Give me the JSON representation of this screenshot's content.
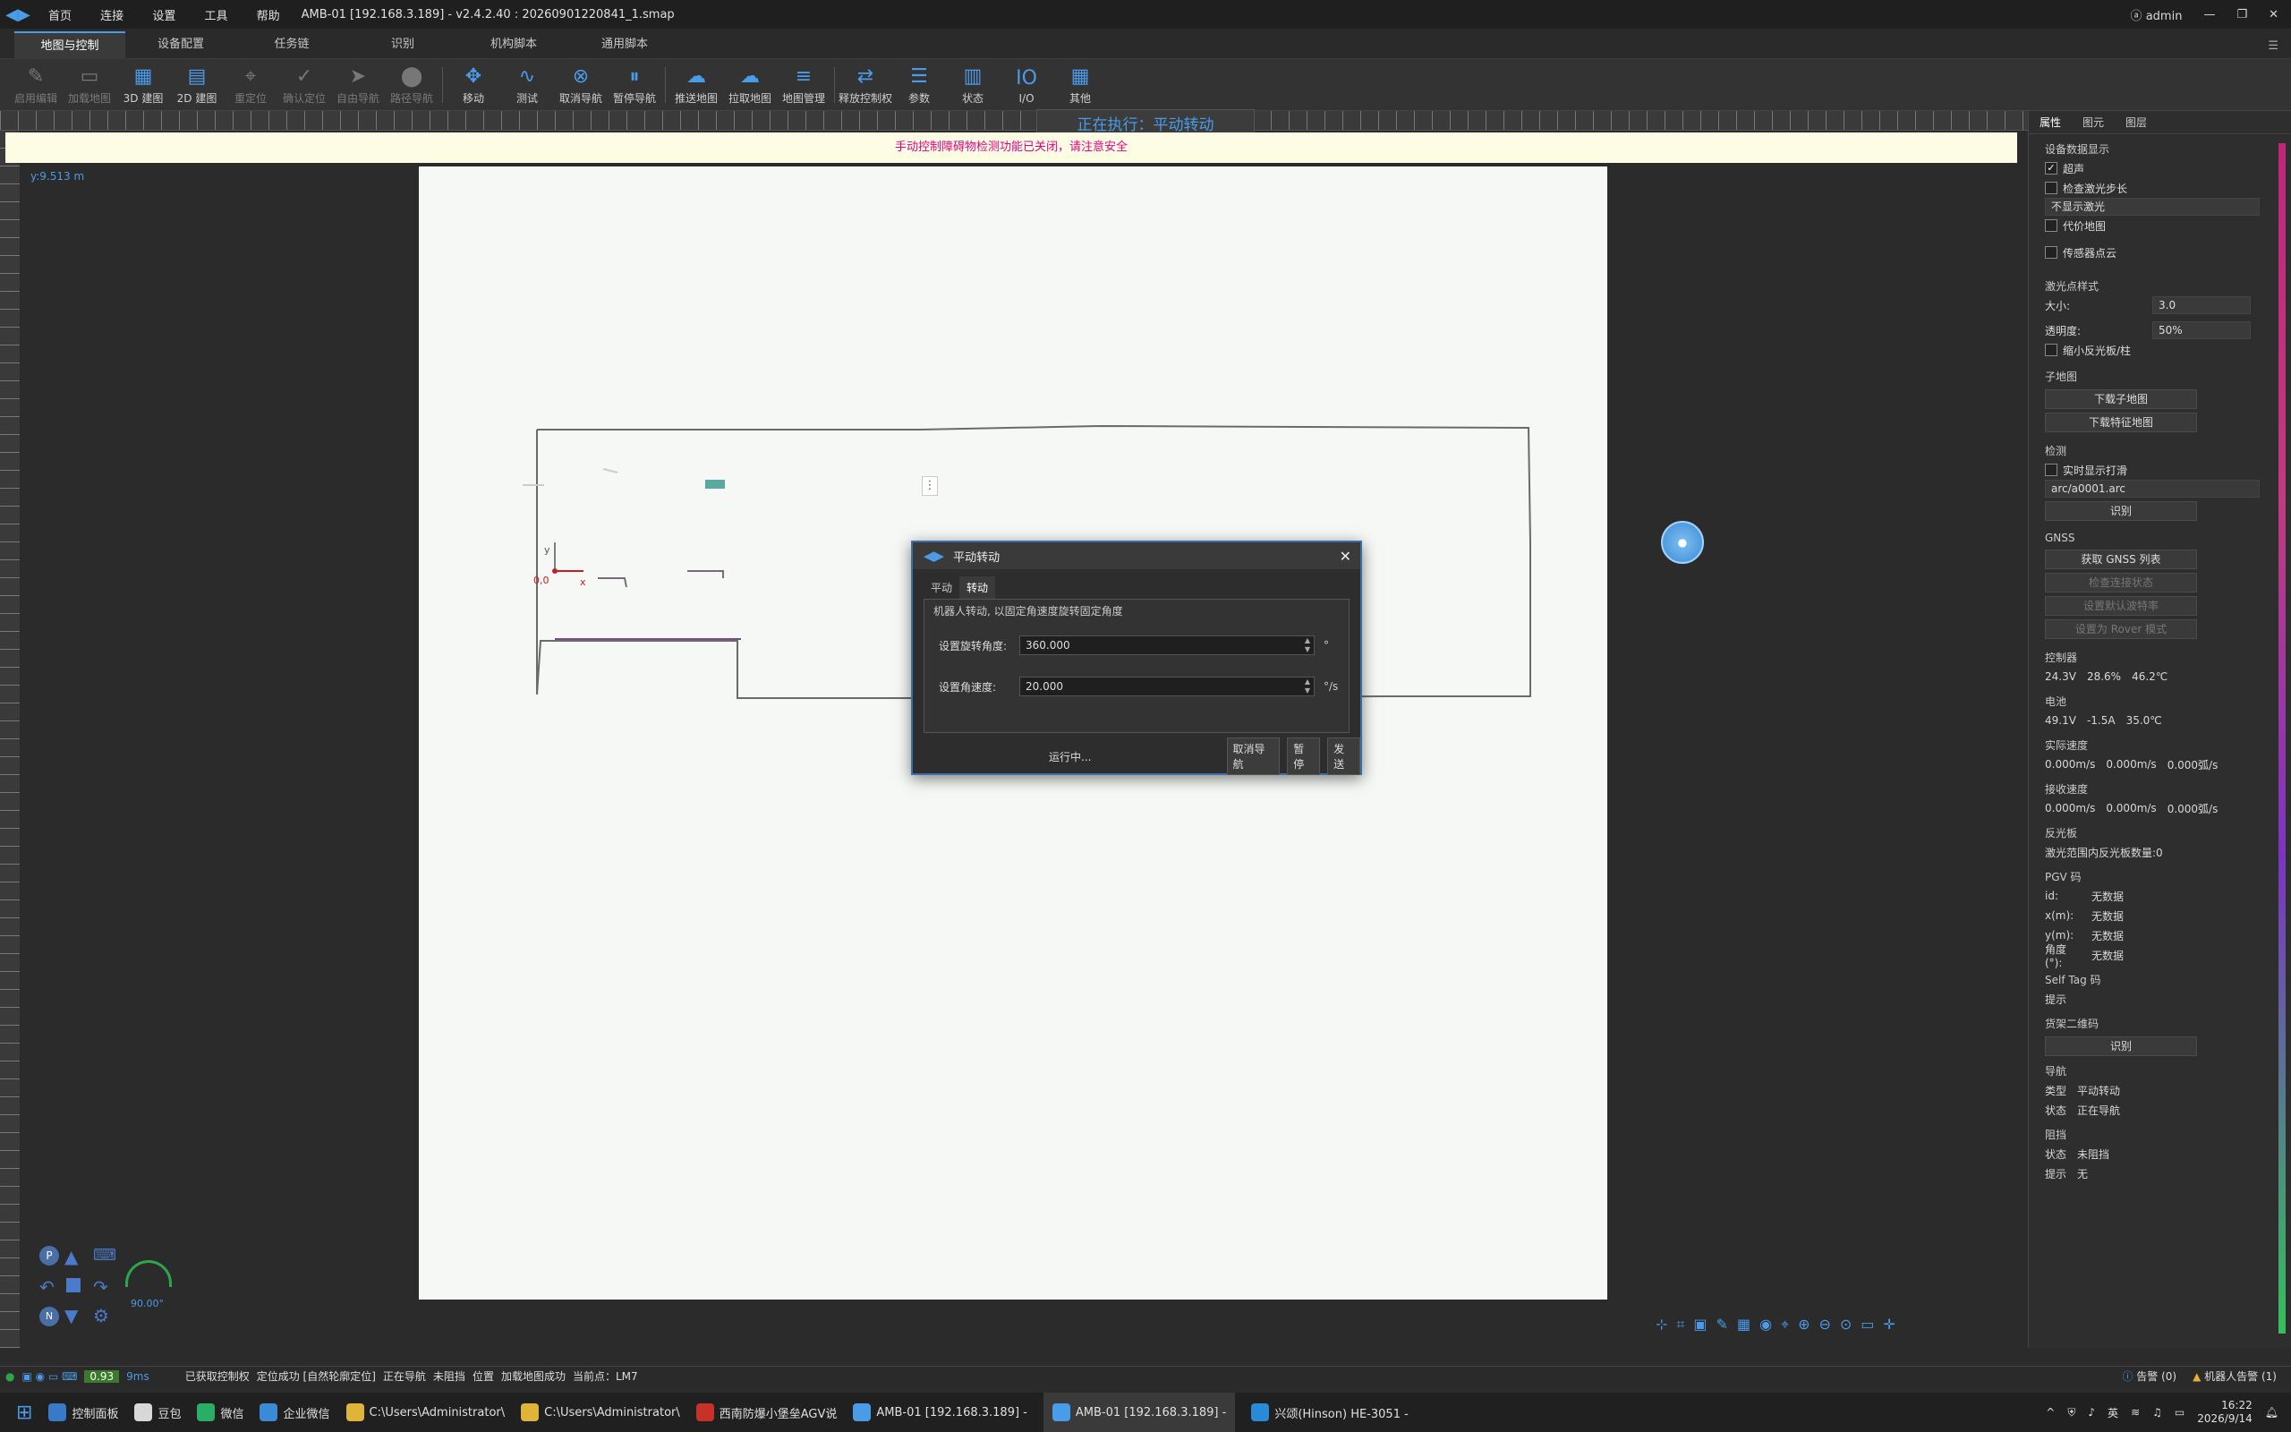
{
  "titlebar": {
    "menu": [
      "首页",
      "连接",
      "设置",
      "工具",
      "帮助"
    ],
    "window_title": "AMB-01 [192.168.3.189] - v2.4.2.40 : 20260901220841_1.smap",
    "user": "admin"
  },
  "tabs": [
    "地图与控制",
    "设备配置",
    "任务链",
    "识别",
    "机构脚本",
    "通用脚本"
  ],
  "toolbar": {
    "tools": [
      {
        "label": "启用编辑",
        "icon": "pen-icon",
        "disabled": true
      },
      {
        "label": "加载地图",
        "icon": "folder-icon",
        "disabled": true
      },
      {
        "label": "3D 建图",
        "icon": "map-3d-icon",
        "disabled": false
      },
      {
        "label": "2D 建图",
        "icon": "map-2d-icon",
        "disabled": false
      },
      {
        "label": "重定位",
        "icon": "crosshair-icon",
        "disabled": true
      },
      {
        "label": "确认定位",
        "icon": "check-circle-icon",
        "disabled": true
      },
      {
        "label": "自由导航",
        "icon": "navigate-icon",
        "disabled": true
      },
      {
        "label": "路径导航",
        "icon": "pin-icon",
        "disabled": true
      },
      {
        "label": "移动",
        "icon": "move-icon",
        "disabled": false
      },
      {
        "label": "测试",
        "icon": "test-icon",
        "disabled": false
      },
      {
        "label": "取消导航",
        "icon": "cancel-circle-icon",
        "disabled": false
      },
      {
        "label": "暂停导航",
        "icon": "pause-icon",
        "disabled": false
      },
      {
        "label": "推送地图",
        "icon": "cloud-upload-icon",
        "disabled": false
      },
      {
        "label": "拉取地图",
        "icon": "cloud-download-icon",
        "disabled": false
      },
      {
        "label": "地图管理",
        "icon": "layers-icon",
        "disabled": false
      },
      {
        "label": "释放控制权",
        "icon": "release-control-icon",
        "disabled": false
      },
      {
        "label": "参数",
        "icon": "params-icon",
        "disabled": false
      },
      {
        "label": "状态",
        "icon": "status-icon",
        "disabled": false
      },
      {
        "label": "I/O",
        "icon": "io-icon",
        "disabled": false
      },
      {
        "label": "其他",
        "icon": "grid-icon",
        "disabled": false
      }
    ]
  },
  "exec_banner": "正在执行：平动转动",
  "warning": "手动控制障碍物检测功能已关闭，请注意安全",
  "coord_readout": "y:9.513 m",
  "map": {
    "origin_label": "0,0",
    "axis_x": "x",
    "axis_y": "y"
  },
  "dialog": {
    "title": "平动转动",
    "tabs": [
      "平动",
      "转动"
    ],
    "group_label": "机器人转动, 以固定角速度旋转固定角度",
    "fields": [
      {
        "label": "设置旋转角度:",
        "value": "360.000",
        "unit": "°"
      },
      {
        "label": "设置角速度:",
        "value": "20.000",
        "unit": "°/s"
      }
    ],
    "status": "运行中...",
    "buttons": [
      "取消导航",
      "暂停",
      "发送"
    ]
  },
  "rpanel": {
    "tabs": [
      "属性",
      "图元",
      "图层"
    ],
    "device_display": {
      "title": "设备数据显示",
      "ultrasonic": "超声",
      "check_laser_step": "检查激光步长",
      "laser_mode": "不显示激光",
      "cost_map": "代价地图",
      "sensor_cloud": "传感器点云"
    },
    "laser_style": {
      "title": "激光点样式",
      "size_label": "大小:",
      "size_value": "3.0",
      "opacity_label": "透明度:",
      "opacity_value": "50%",
      "shrink_reflector": "缩小反光板/柱"
    },
    "submap": {
      "title": "子地图",
      "download_submap": "下载子地图",
      "download_feature": "下载特征地图"
    },
    "detect": {
      "title": "检测",
      "realtime": "实时显示打滑",
      "file": "arc/a0001.arc",
      "recognize": "识别"
    },
    "gnss": {
      "title": "GNSS",
      "get_list": "获取 GNSS 列表",
      "check_conn": "检查连接状态",
      "set_default": "设置默认波特率",
      "set_rover": "设置为 Rover 模式"
    },
    "controller": {
      "title": "控制器",
      "voltage": "24.3V",
      "load": "28.6%",
      "temp": "46.2℃"
    },
    "battery": {
      "title": "电池",
      "voltage": "49.1V",
      "current": "-1.5A",
      "temp": "35.0℃"
    },
    "actual_speed": {
      "title": "实际速度",
      "vx": "0.000m/s",
      "vy": "0.000m/s",
      "w": "0.000弧/s"
    },
    "received_speed": {
      "title": "接收速度",
      "vx": "0.000m/s",
      "vy": "0.000m/s",
      "w": "0.000弧/s"
    },
    "reflector": {
      "title": "反光板",
      "count_label": "激光范围内反光板数量:",
      "count": "0"
    },
    "pgv": {
      "title": "PGV 码",
      "id_label": "id:",
      "id": "无数据",
      "x_label": "x(m):",
      "x": "无数据",
      "y_label": "y(m):",
      "y": "无数据",
      "angle_label": "角度(°):",
      "angle": "无数据"
    },
    "self_tag": {
      "title": "Self Tag 码",
      "hint_label": "提示"
    },
    "shelf_qr": {
      "title": "货架二维码",
      "recognize": "识别"
    },
    "nav": {
      "title": "导航",
      "type_label": "类型",
      "type": "平动转动",
      "state_label": "状态",
      "state": "正在导航"
    },
    "block": {
      "title": "阻挡",
      "state_label": "状态",
      "state": "未阻挡",
      "hint_label": "提示",
      "hint": "无"
    }
  },
  "statusbar": {
    "latency_value": "0.93",
    "latency_ms": "9ms",
    "items": [
      "已获取控制权",
      "定位成功 [自然轮廓定位]",
      "正在导航",
      "未阻挡",
      "位置",
      "加载地图成功",
      "当前点：LM7"
    ],
    "alarm": "告警 (0)",
    "robot_alarm": "机器人告警 (1)"
  },
  "map_controls": {
    "heading": "90.00°"
  },
  "taskbar": {
    "items": [
      {
        "label": "控制面板",
        "color": "#3a78c8"
      },
      {
        "label": "豆包",
        "color": "#d8d8d8"
      },
      {
        "label": "微信",
        "color": "#2aae67"
      },
      {
        "label": "企业微信",
        "color": "#3a8ad6"
      },
      {
        "label": "C:\\Users\\Administrator\\",
        "color": "#e0b33a"
      },
      {
        "label": "C:\\Users\\Administrator\\",
        "color": "#e0b33a"
      },
      {
        "label": "西南防爆小堡垒AGV说",
        "color": "#c8302a"
      },
      {
        "label": "AMB-01 [192.168.3.189] -",
        "color": "#4a9be8"
      },
      {
        "label": "AMB-01 [192.168.3.189] -",
        "color": "#4a9be8"
      },
      {
        "label": "兴颂(Hinson) HE-3051 -",
        "color": "#2a8ad6"
      }
    ],
    "ime": "英",
    "time": "16:22",
    "date": "2026/9/14"
  }
}
